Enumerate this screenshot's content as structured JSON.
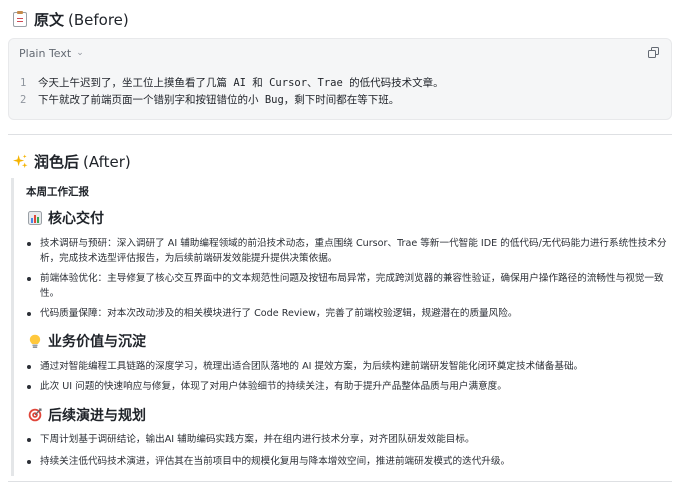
{
  "before": {
    "title_cn": "原文",
    "title_en": "(Before)",
    "code": {
      "lang": "Plain Text",
      "lines": [
        {
          "no": "1",
          "text": "今天上午迟到了，坐工位上摸鱼看了几篇 AI 和 Cursor、Trae 的低代码技术文章。"
        },
        {
          "no": "2",
          "text": "下午就改了前端页面一个错别字和按钮错位的小 Bug，剩下时间都在等下班。"
        }
      ]
    }
  },
  "after": {
    "title_cn": "润色后",
    "title_en": "(After)",
    "report_title": "本周工作汇报",
    "sections": [
      {
        "title": "核心交付",
        "icon": "bar-chart-icon",
        "items": [
          "技术调研与预研：深入调研了 AI 辅助编程领域的前沿技术动态，重点围绕 Cursor、Trae 等新一代智能 IDE 的低代码/无代码能力进行系统性技术分析，完成技术选型评估报告，为后续前端研发效能提升提供决策依据。",
          "前端体验优化：主导修复了核心交互界面中的文本规范性问题及按钮布局异常，完成跨浏览器的兼容性验证，确保用户操作路径的流畅性与视觉一致性。",
          "代码质量保障：对本次改动涉及的相关模块进行了 Code Review，完善了前端校验逻辑，规避潜在的质量风险。"
        ]
      },
      {
        "title": "业务价值与沉淀",
        "icon": "lightbulb-icon",
        "items": [
          "通过对智能编程工具链路的深度学习，梳理出适合团队落地的 AI 提效方案，为后续构建前端研发智能化闭环奠定技术储备基础。",
          "此次 UI 问题的快速响应与修复，体现了对用户体验细节的持续关注，有助于提升产品整体品质与用户满意度。"
        ]
      },
      {
        "title": "后续演进与规划",
        "icon": "target-icon",
        "items": [
          "下周计划基于调研结论，输出AI 辅助编码实践方案，并在组内进行技术分享，对齐团队研发效能目标。",
          "持续关注低代码技术演进，评估其在当前项目中的规模化复用与降本增效空间，推进前端研发模式的迭代升级。"
        ]
      }
    ]
  }
}
